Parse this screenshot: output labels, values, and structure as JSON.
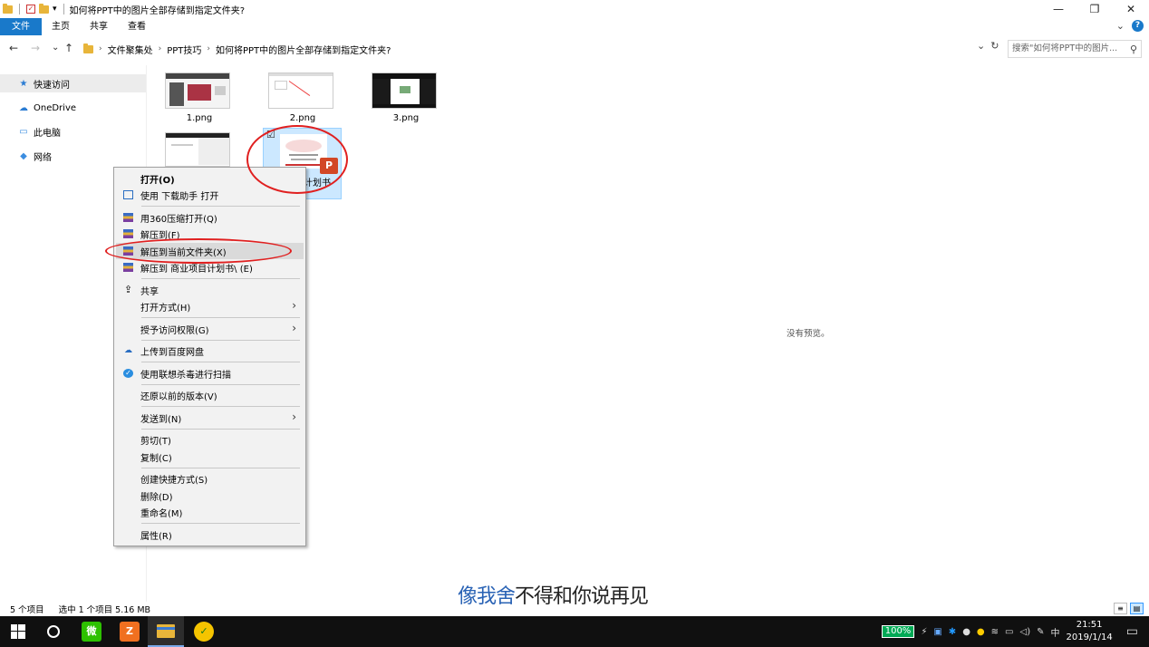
{
  "window": {
    "title": "如何将PPT中的图片全部存储到指定文件夹?",
    "quick_access_arrow": "▾",
    "buttons": {
      "minimize": "—",
      "maximize": "❐",
      "close": "✕"
    }
  },
  "ribbon": {
    "tabs": [
      "文件",
      "主页",
      "共享",
      "查看"
    ],
    "expand": "⌄",
    "help": "?"
  },
  "address": {
    "back": "←",
    "forward": "→",
    "recent": "⌄",
    "up": "↑",
    "crumbs": [
      "文件聚集处",
      "PPT技巧",
      "如何将PPT中的图片全部存储到指定文件夹?"
    ],
    "crumb_sep": "›",
    "dropdown": "⌄",
    "refresh": "↻",
    "search_placeholder": "搜索\"如何将PPT中的图片...",
    "search_icon": "⚲"
  },
  "sidebar": {
    "items": [
      {
        "label": "快速访问",
        "icon": "star-icon",
        "glyph": "★",
        "color": "#2b7cd3"
      },
      {
        "label": "OneDrive",
        "icon": "cloud-icon",
        "glyph": "☁",
        "color": "#2b7cd3"
      },
      {
        "label": "此电脑",
        "icon": "computer-icon",
        "glyph": "▭",
        "color": "#3b8de0"
      },
      {
        "label": "网络",
        "icon": "network-icon",
        "glyph": "◆",
        "color": "#3b8de0"
      }
    ]
  },
  "files": [
    {
      "name": "1.png"
    },
    {
      "name": "2.png"
    },
    {
      "name": "3.png"
    },
    {
      "name": ""
    },
    {
      "name": "计划书",
      "selected": true,
      "checkbox": "☑",
      "badge": "P"
    }
  ],
  "preview": {
    "text": "没有预览。"
  },
  "context_menu": {
    "items": [
      {
        "label": "打开(O)",
        "bold": true
      },
      {
        "label": "使用 下载助手 打开",
        "icon": "download-helper-icon"
      },
      {
        "label": "用360压缩打开(Q)",
        "icon": "archive-icon"
      },
      {
        "label": "解压到(F)",
        "icon": "archive-icon"
      },
      {
        "label": "解压到当前文件夹(X)",
        "icon": "archive-icon",
        "highlight": true
      },
      {
        "label": "解压到 商业项目计划书\\ (E)",
        "icon": "archive-icon"
      },
      {
        "label": "共享",
        "icon": "share-icon"
      },
      {
        "label": "打开方式(H)",
        "submenu": true
      },
      {
        "label": "授予访问权限(G)",
        "submenu": true
      },
      {
        "label": "上传到百度网盘",
        "icon": "baidu-cloud-icon"
      },
      {
        "label": "使用联想杀毒进行扫描",
        "icon": "lenovo-antivirus-icon"
      },
      {
        "label": "还原以前的版本(V)"
      },
      {
        "label": "发送到(N)",
        "submenu": true
      },
      {
        "label": "剪切(T)"
      },
      {
        "label": "复制(C)"
      },
      {
        "label": "创建快捷方式(S)"
      },
      {
        "label": "删除(D)"
      },
      {
        "label": "重命名(M)"
      },
      {
        "label": "属性(R)"
      }
    ],
    "submenu_arrow": "›",
    "share_glyph": "⇪"
  },
  "status": {
    "count": "5 个项目",
    "selection": "选中 1 个项目  5.16 MB"
  },
  "subtitle": {
    "highlighted": "像我舍",
    "rest": "不得和你说再见"
  },
  "taskbar": {
    "battery": "100%",
    "ime": "中",
    "time": "21:51",
    "date": "2019/1/14",
    "app_wechat": "微",
    "app_orange": "Z",
    "app_green": "✓"
  }
}
